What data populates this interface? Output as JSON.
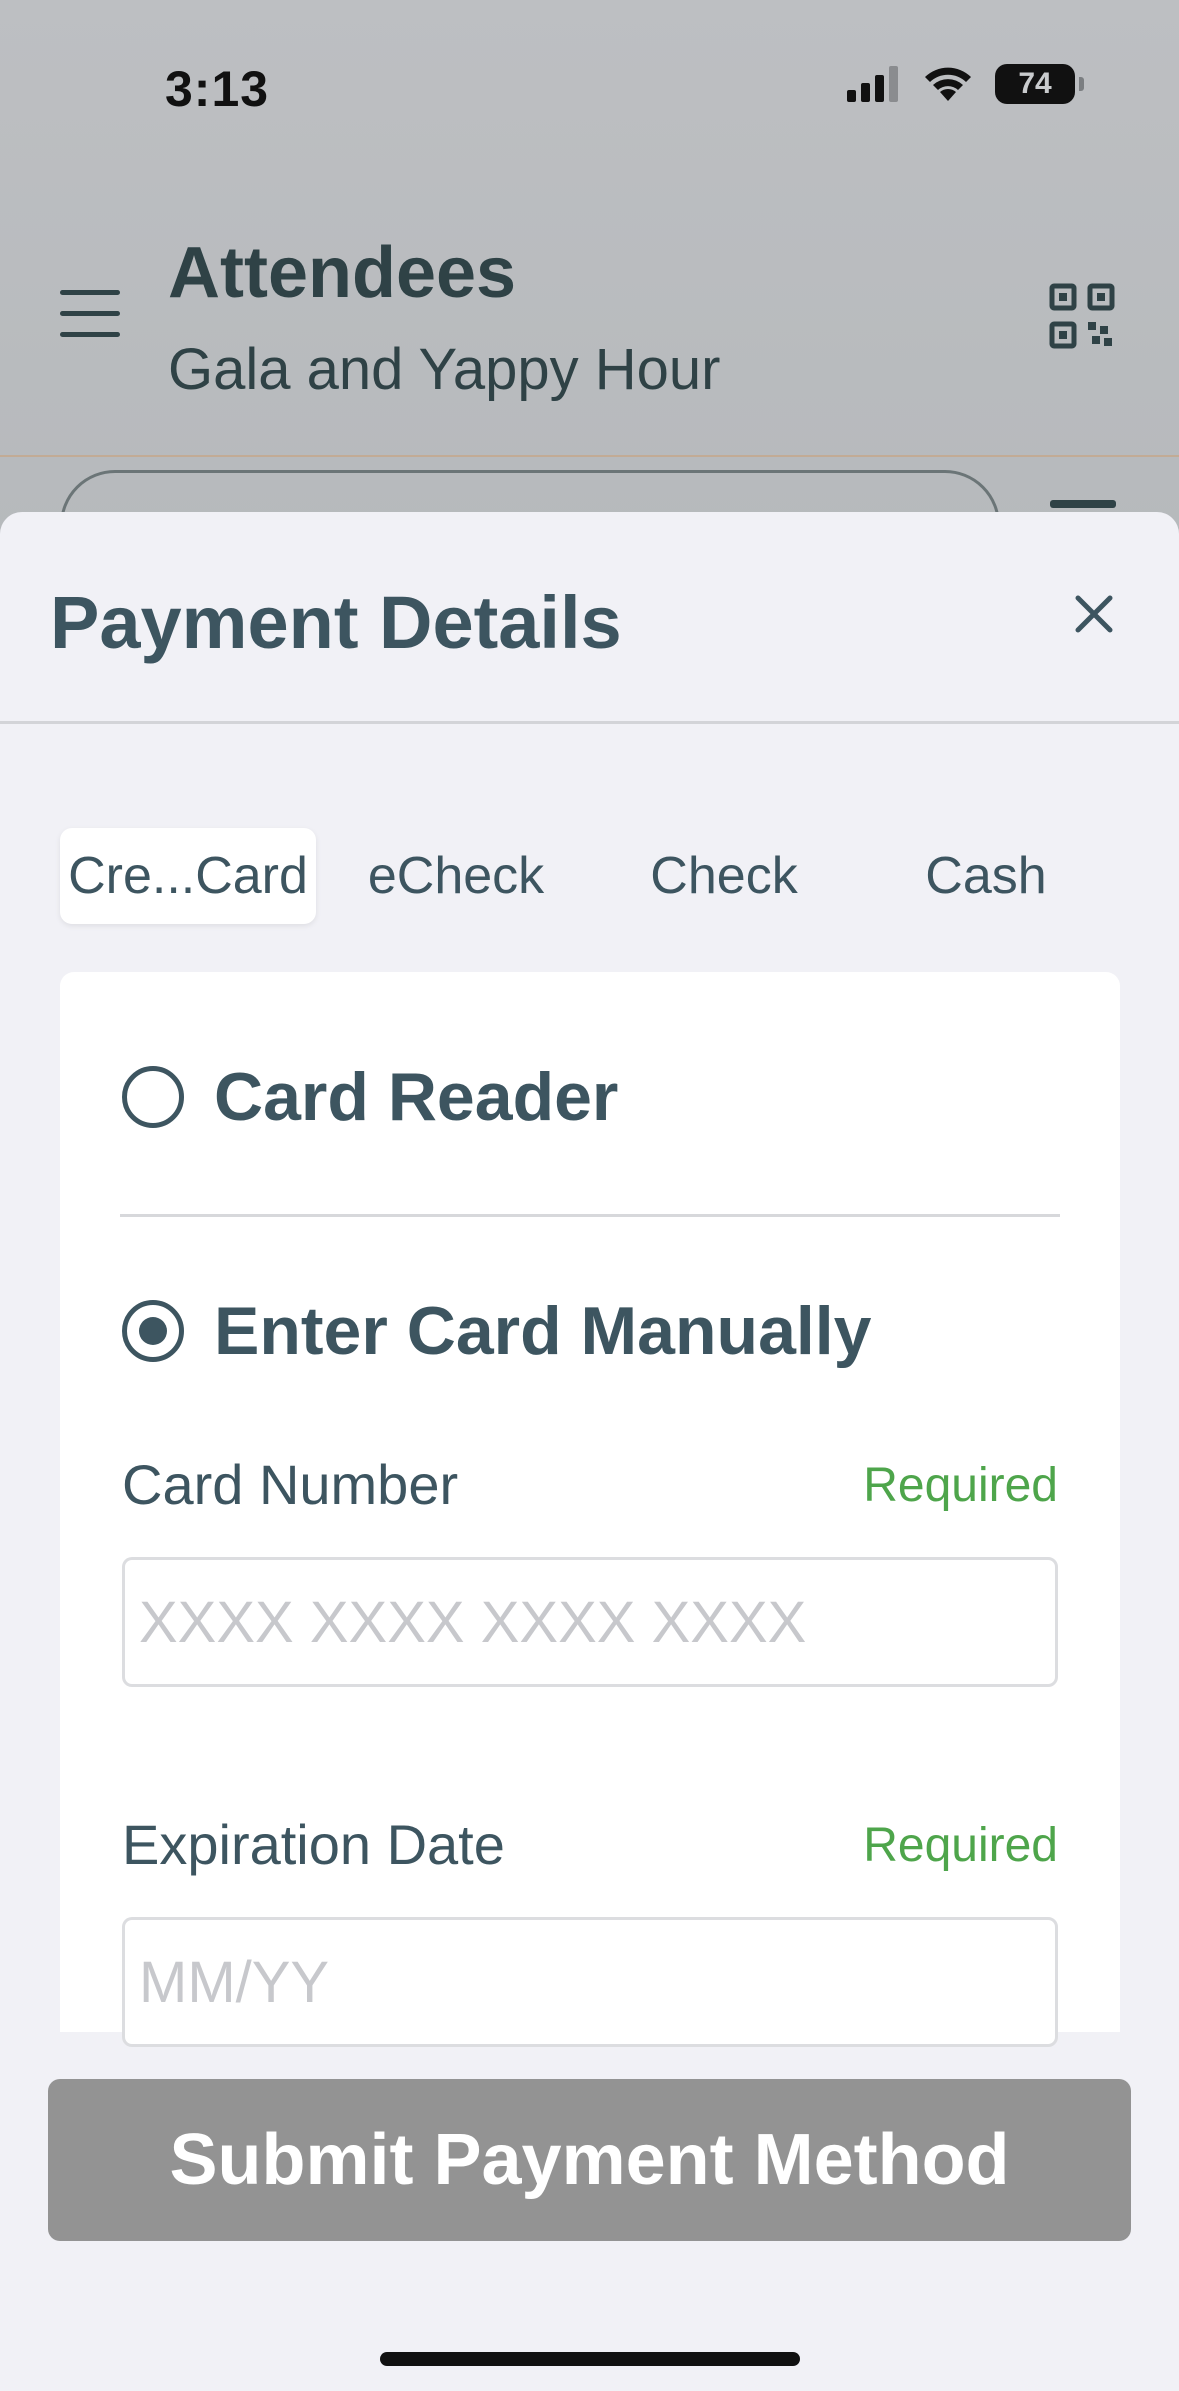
{
  "status_bar": {
    "time": "3:13",
    "battery": "74"
  },
  "header": {
    "title": "Attendees",
    "subtitle": "Gala and Yappy Hour"
  },
  "sheet": {
    "title": "Payment Details",
    "tabs": [
      {
        "label": "Cre...Card",
        "active": true
      },
      {
        "label": "eCheck",
        "active": false
      },
      {
        "label": "Check",
        "active": false
      },
      {
        "label": "Cash",
        "active": false
      }
    ],
    "options": {
      "card_reader": "Card Reader",
      "manual": "Enter Card Manually",
      "selected": "manual"
    },
    "fields": {
      "card_number": {
        "label": "Card Number",
        "required": "Required",
        "placeholder": "XXXX XXXX XXXX XXXX",
        "value": ""
      },
      "expiration": {
        "label": "Expiration Date",
        "required": "Required",
        "placeholder": "MM/YY",
        "value": ""
      }
    },
    "submit_label": "Submit Payment Method"
  },
  "colors": {
    "primary_text": "#3d5560",
    "required": "#4ea54b",
    "button_disabled": "#939393"
  }
}
